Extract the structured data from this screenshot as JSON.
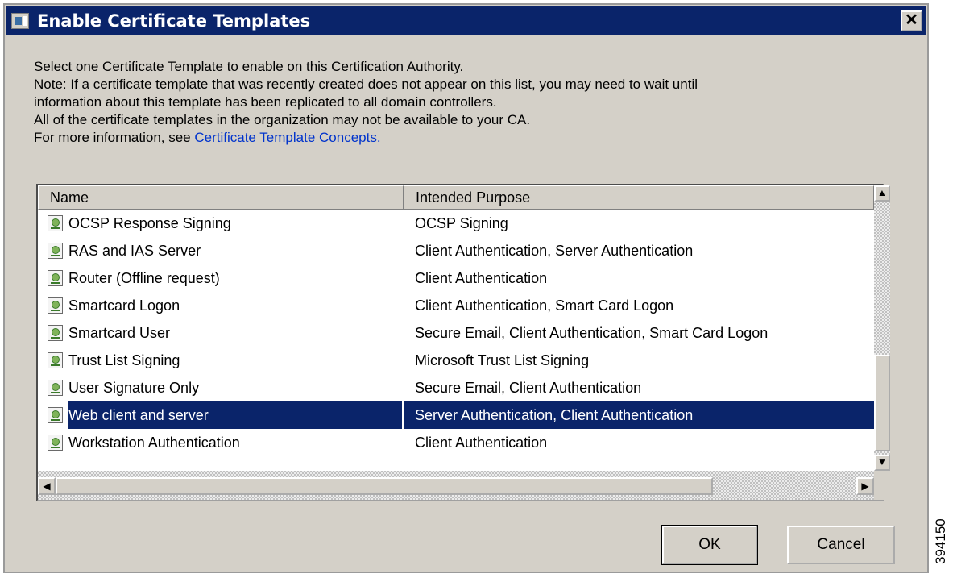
{
  "dialog": {
    "title": "Enable Certificate Templates",
    "close_label": "✕",
    "description_lines": [
      "Select one Certificate Template to enable on this Certification Authority.",
      "Note: If a certificate template that was recently created does not appear on this list, you may need to wait until",
      "information about this template has been replicated to all domain controllers.",
      "All of the certificate templates in the organization may not be available to your CA."
    ],
    "more_info_prefix": "For more information, see ",
    "more_info_link": "Certificate Template Concepts."
  },
  "list": {
    "columns": [
      "Name",
      "Intended Purpose"
    ],
    "rows": [
      {
        "name": "OCSP Response Signing",
        "purpose": "OCSP Signing",
        "selected": false
      },
      {
        "name": "RAS and IAS Server",
        "purpose": "Client Authentication, Server Authentication",
        "selected": false
      },
      {
        "name": "Router (Offline request)",
        "purpose": "Client Authentication",
        "selected": false
      },
      {
        "name": "Smartcard Logon",
        "purpose": "Client Authentication, Smart Card Logon",
        "selected": false
      },
      {
        "name": "Smartcard User",
        "purpose": "Secure Email, Client Authentication, Smart Card Logon",
        "selected": false
      },
      {
        "name": "Trust List Signing",
        "purpose": "Microsoft Trust List Signing",
        "selected": false
      },
      {
        "name": "User Signature Only",
        "purpose": "Secure Email, Client Authentication",
        "selected": false
      },
      {
        "name": "Web client and server",
        "purpose": "Server Authentication, Client Authentication",
        "selected": true
      },
      {
        "name": "Workstation Authentication",
        "purpose": "Client Authentication",
        "selected": false
      }
    ],
    "scroll_up": "▲",
    "scroll_down": "▼",
    "scroll_left": "◀",
    "scroll_right": "▶"
  },
  "buttons": {
    "ok": "OK",
    "cancel": "Cancel"
  },
  "figure_id": "394150",
  "colors": {
    "titlebar": "#0a246a",
    "selection": "#0a246a",
    "dialog_bg": "#d4d0c8",
    "link": "#0033cc"
  }
}
